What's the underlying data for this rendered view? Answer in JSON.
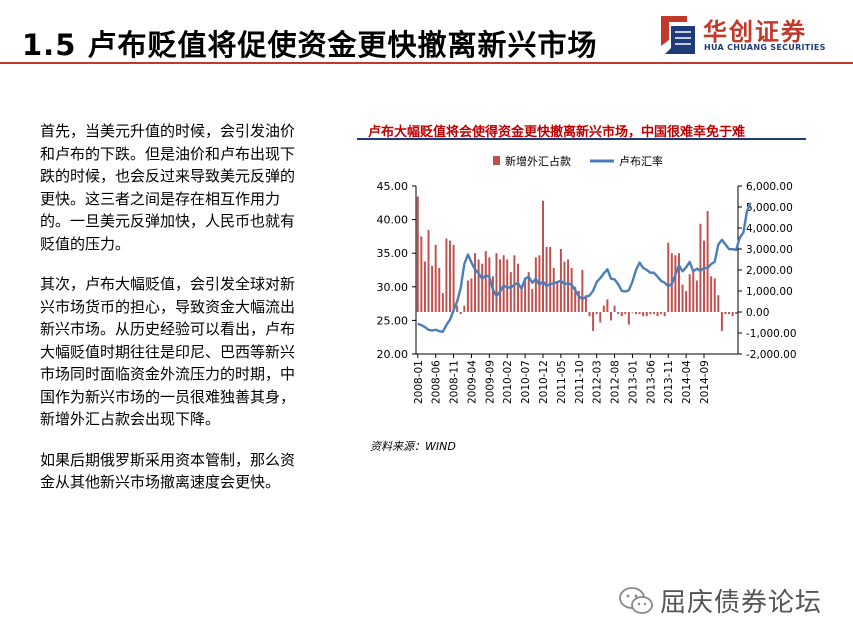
{
  "slide": {
    "title": "1.5 卢布贬值将促使资金更快撤离新兴市场"
  },
  "logo": {
    "name_cn": "华创证券",
    "name_en": "HUA CHUANG SECURITIES",
    "colors": {
      "red": "#c0392b",
      "blue": "#1f3a78"
    }
  },
  "body_text": {
    "p1": "首先，当美元升值的时候，会引发油价和卢布的下跌。但是油价和卢布出现下跌的时候，也会反过来导致美元反弹的更快。这三者之间是存在相互作用力的。一旦美元反弹加快，人民币也就有贬值的压力。",
    "p2": "其次，卢布大幅贬值，会引发全球对新兴市场货币的担心，导致资金大幅流出新兴市场。从历史经验可以看出，卢布大幅贬值时期往往是印尼、巴西等新兴市场同时面临资金外流压力的时期，中国作为新兴市场的一员很难独善其身，新增外汇占款会出现下降。",
    "p3": "如果后期俄罗斯采用资本管制，那么资金从其他新兴市场撤离速度会更快。"
  },
  "chart_title": "卢布大幅贬值将会使得资金更快撤离新兴市场，中国很难幸免于难",
  "source": "资料来源：WIND",
  "footer": {
    "text": "屈庆债券论坛",
    "icon": "wechat-icon"
  },
  "chart_data": {
    "type": "bar",
    "title": "卢布大幅贬值将会使得资金更快撤离新兴市场，中国很难幸免于难",
    "legend_placement": "top",
    "grid": false,
    "x_range": [
      "2008-01",
      "2014-11"
    ],
    "x_ticks": [
      "2008-01",
      "2008-06",
      "2008-11",
      "2009-04",
      "2009-09",
      "2010-02",
      "2010-07",
      "2010-12",
      "2011-05",
      "2011-10",
      "2012-03",
      "2012-08",
      "2013-01",
      "2013-06",
      "2013-11",
      "2014-04",
      "2014-09"
    ],
    "y_left": {
      "ticks": [
        "20.00",
        "25.00",
        "30.00",
        "35.00",
        "40.00",
        "45.00"
      ],
      "ylim": [
        20,
        45
      ]
    },
    "y_right": {
      "ticks": [
        "-2,000.00",
        "-1,000.00",
        "0.00",
        "1,000.00",
        "2,000.00",
        "3,000.00",
        "4,000.00",
        "5,000.00",
        "6,000.00"
      ],
      "ylim": [
        -2000,
        6000
      ]
    },
    "series": [
      {
        "name": "新增外汇占款",
        "type": "bar",
        "axis": "right",
        "color": "#c0504d",
        "values": [
          5500,
          3600,
          2400,
          3900,
          2200,
          3200,
          2100,
          900,
          3500,
          3400,
          3200,
          300,
          -100,
          300,
          1500,
          1600,
          2800,
          2500,
          2300,
          2900,
          2600,
          1700,
          2800,
          2500,
          2700,
          2500,
          1900,
          2700,
          2300,
          1200,
          1600,
          1900,
          1100,
          2600,
          2700,
          5300,
          3100,
          3100,
          2100,
          1400,
          3000,
          2400,
          2500,
          2100,
          1200,
          1000,
          2000,
          800,
          -200,
          -900,
          -100,
          -500,
          300,
          600,
          -400,
          300,
          -100,
          -200,
          -100,
          -600,
          0,
          -100,
          -100,
          -200,
          -200,
          -100,
          -100,
          -200,
          -100,
          -200,
          3300,
          2800,
          2700,
          2800,
          1300,
          1000,
          1800,
          2000,
          1500,
          4200,
          3400,
          4800,
          1700,
          1600,
          800,
          -900,
          -100,
          -100,
          -200,
          -100
        ]
      },
      {
        "name": "卢布汇率",
        "type": "line",
        "axis": "left",
        "color": "#4a7ebb",
        "values": [
          24.5,
          24.3,
          24.0,
          23.6,
          23.5,
          23.6,
          23.4,
          23.3,
          24.3,
          25.1,
          26.5,
          27.8,
          29.8,
          33.4,
          34.8,
          33.6,
          32.6,
          32.0,
          31.2,
          31.7,
          31.5,
          29.6,
          28.6,
          29.3,
          30.2,
          29.9,
          29.9,
          30.3,
          30.6,
          29.7,
          31.2,
          31.5,
          30.6,
          31.2,
          30.3,
          30.8,
          30.1,
          30.4,
          30.5,
          30.7,
          30.9,
          30.4,
          30.5,
          30.3,
          29.5,
          28.6,
          28.2,
          28.5,
          28.7,
          29.4,
          30.7,
          31.3,
          32.0,
          32.6,
          31.2,
          31.1,
          30.4,
          29.4,
          29.3,
          29.5,
          30.8,
          32.5,
          33.6,
          32.8,
          32.5,
          32.1,
          32.1,
          31.5,
          30.9,
          30.6,
          30.1,
          30.4,
          31.8,
          33.2,
          32.3,
          32.9,
          33.7,
          32.3,
          32.7,
          32.4,
          32.8,
          32.8,
          33.4,
          33.7,
          36.3,
          37.0,
          36.3,
          35.6,
          35.6,
          35.5,
          37.3,
          38.1,
          41.2,
          42.5
        ]
      }
    ]
  }
}
